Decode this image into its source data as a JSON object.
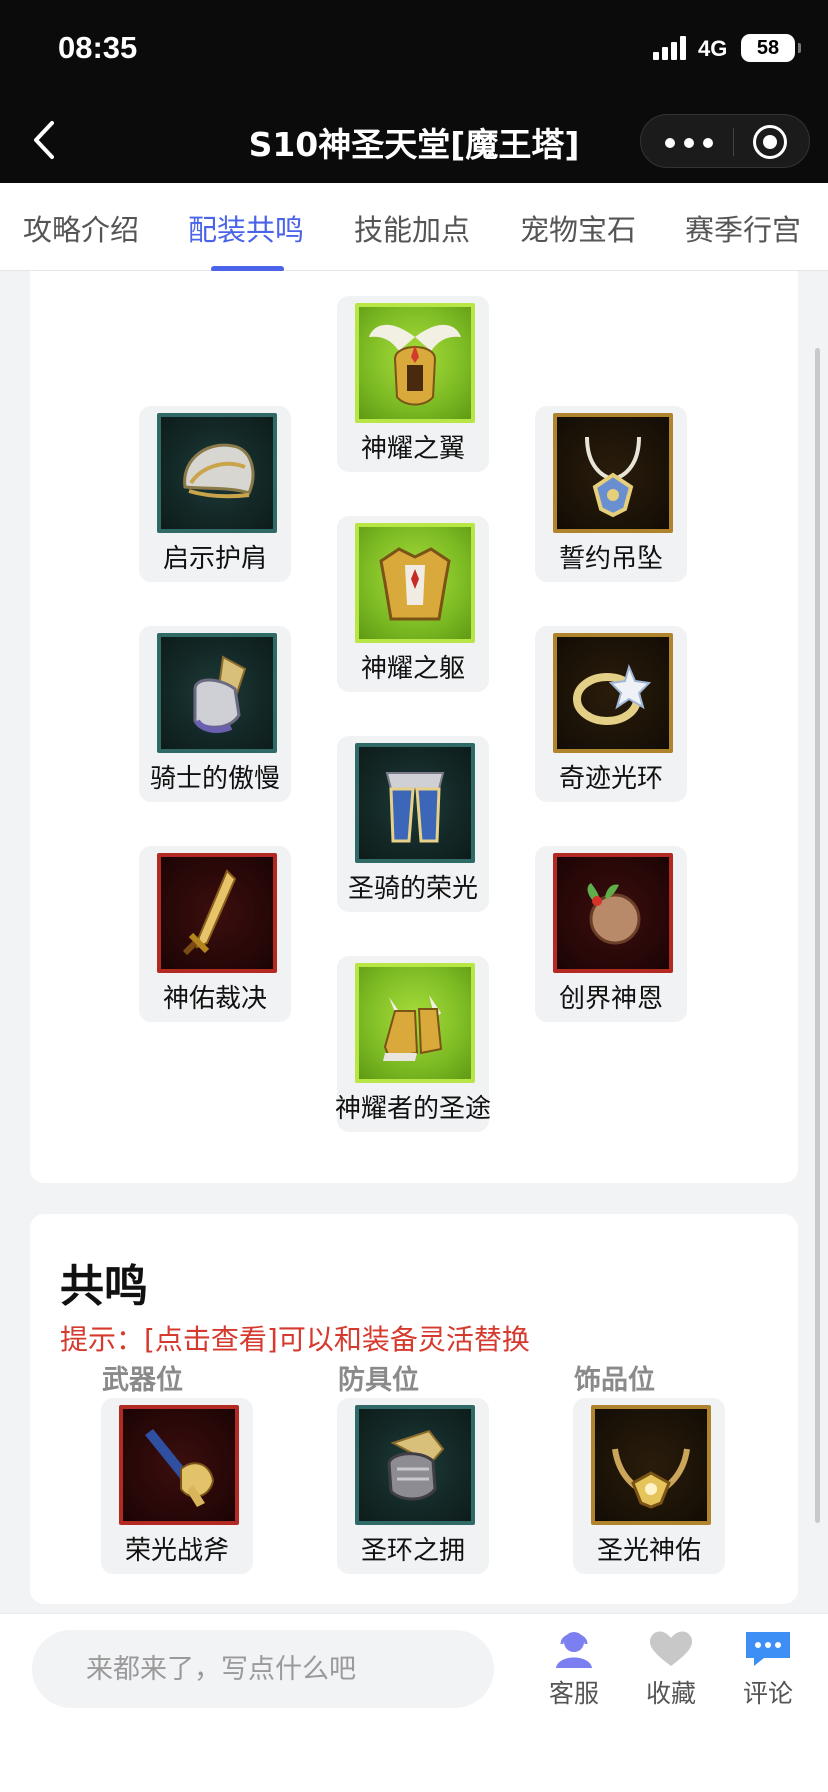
{
  "status_bar": {
    "time": "08:35",
    "network": "4G",
    "battery": "58"
  },
  "nav": {
    "title": "S10神圣天堂[魔王塔]"
  },
  "tabs": [
    {
      "label": "攻略介绍"
    },
    {
      "label": "配装共鸣"
    },
    {
      "label": "技能加点"
    },
    {
      "label": "宠物宝石"
    },
    {
      "label": "赛季行宫"
    }
  ],
  "active_tab": "配装共鸣",
  "equipment": [
    {
      "name": "神耀之翼",
      "rarity": "green",
      "icon": "winged-helmet-icon"
    },
    {
      "name": "启示护肩",
      "rarity": "teal",
      "icon": "shoulder-armor-icon"
    },
    {
      "name": "誓约吊坠",
      "rarity": "gold",
      "icon": "pendant-icon"
    },
    {
      "name": "神耀之躯",
      "rarity": "green",
      "icon": "chest-armor-icon"
    },
    {
      "name": "骑士的傲慢",
      "rarity": "teal",
      "icon": "gauntlet-icon"
    },
    {
      "name": "奇迹光环",
      "rarity": "gold",
      "icon": "ring-icon"
    },
    {
      "name": "圣骑的荣光",
      "rarity": "teal",
      "icon": "leg-armor-icon"
    },
    {
      "name": "神佑裁决",
      "rarity": "red",
      "icon": "sword-icon"
    },
    {
      "name": "创界神恩",
      "rarity": "red",
      "icon": "orb-icon"
    },
    {
      "name": "神耀者的圣途",
      "rarity": "green",
      "icon": "winged-boots-icon"
    }
  ],
  "resonance": {
    "title": "共鸣",
    "hint": "提示：[点击查看]可以和装备灵活替换",
    "slots": [
      {
        "slot": "武器位",
        "name": "荣光战斧",
        "rarity": "red",
        "icon": "axe-icon"
      },
      {
        "slot": "防具位",
        "name": "圣环之拥",
        "rarity": "teal",
        "icon": "armored-glove-icon"
      },
      {
        "slot": "饰品位",
        "name": "圣光神佑",
        "rarity": "gold",
        "icon": "necklace-icon"
      }
    ]
  },
  "bottom_bar": {
    "comment_placeholder": "来都来了，写点什么吧",
    "actions": [
      {
        "label": "客服",
        "icon": "customer-service-icon",
        "color": "#7b7ff0"
      },
      {
        "label": "收藏",
        "icon": "heart-icon",
        "color": "#c8c8c8"
      },
      {
        "label": "评论",
        "icon": "comment-bubble-icon",
        "color": "#3d8ef5"
      }
    ]
  },
  "colors": {
    "accent": "#4a63e8",
    "hint": "#d63a2e",
    "rarity_green": "#b9e647",
    "rarity_teal": "#2f6a66",
    "rarity_gold": "#b0842c",
    "rarity_red": "#b32a22"
  }
}
